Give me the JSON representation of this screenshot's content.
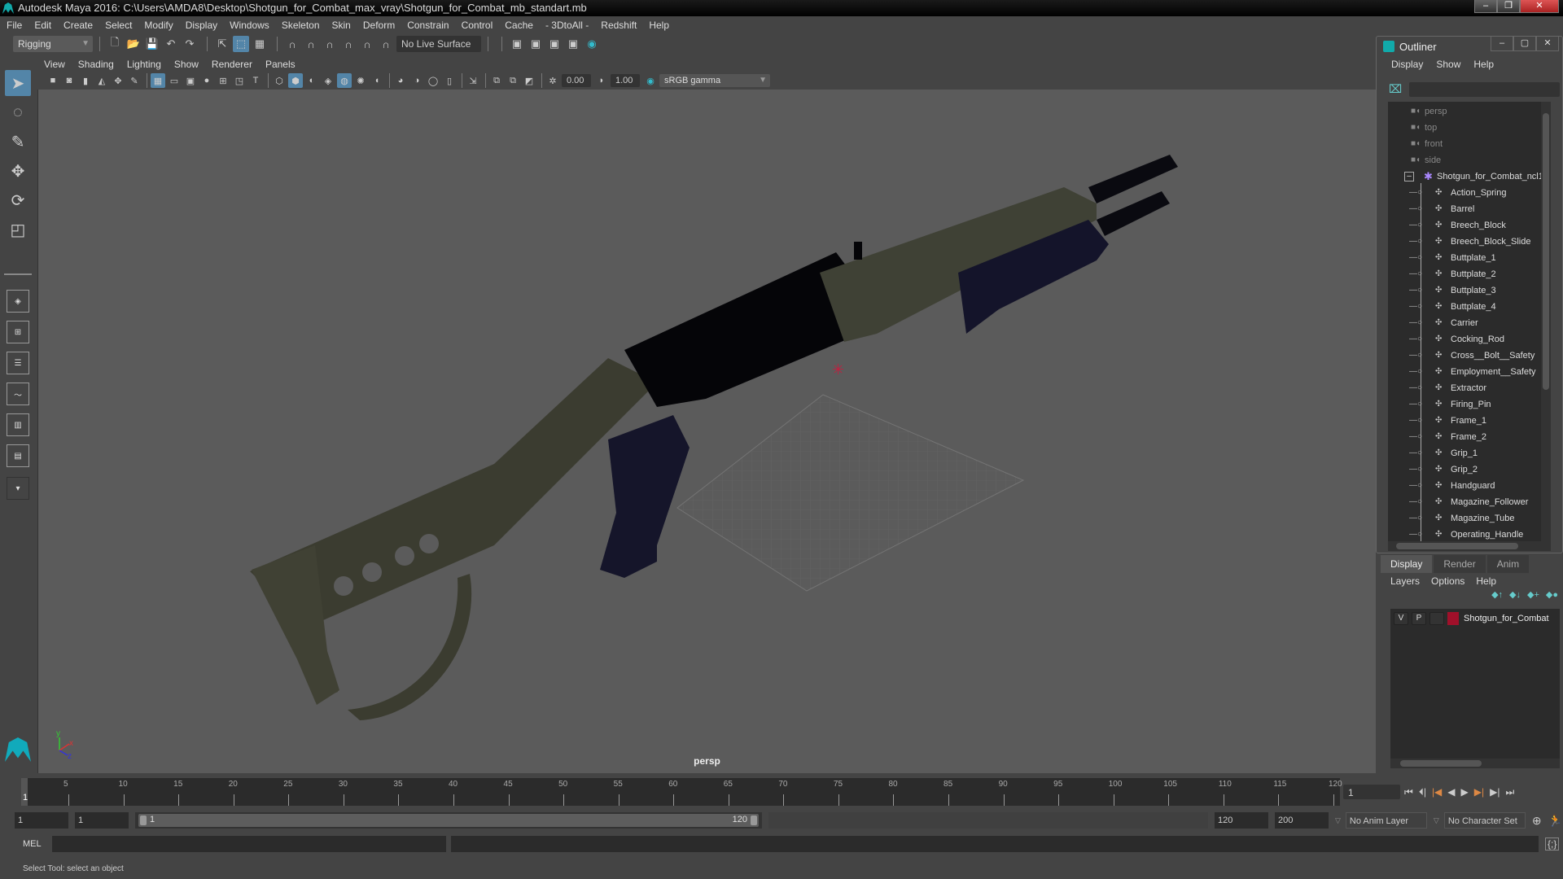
{
  "window": {
    "title": "Autodesk Maya 2016: C:\\Users\\AMDA8\\Desktop\\Shotgun_for_Combat_max_vray\\Shotgun_for_Combat_mb_standart.mb",
    "minimize": "–",
    "restore": "❐",
    "close": "✕"
  },
  "menubar": [
    "File",
    "Edit",
    "Create",
    "Select",
    "Modify",
    "Display",
    "Windows",
    "Skeleton",
    "Skin",
    "Deform",
    "Constrain",
    "Control",
    "Cache",
    "- 3DtoAll -",
    "Redshift",
    "Help"
  ],
  "shelf": {
    "mode": "Rigging",
    "live_surface": "No Live Surface"
  },
  "viewport": {
    "menu": [
      "View",
      "Shading",
      "Lighting",
      "Show",
      "Renderer",
      "Panels"
    ],
    "exposure": "0.00",
    "gamma": "1.00",
    "color_space": "sRGB gamma",
    "camera_name": "persp",
    "axis": {
      "x": "x",
      "y": "y",
      "z": "z"
    }
  },
  "outliner": {
    "title": "Outliner",
    "menu": [
      "Display",
      "Show",
      "Help"
    ],
    "cameras": [
      "persp",
      "top",
      "front",
      "side"
    ],
    "group": "Shotgun_for_Combat_ncl1",
    "children": [
      "Action_Spring",
      "Barrel",
      "Breech_Block",
      "Breech_Block_Slide",
      "Buttplate_1",
      "Buttplate_2",
      "Buttplate_3",
      "Buttplate_4",
      "Carrier",
      "Cocking_Rod",
      "Cross__Bolt__Safety",
      "Employment__Safety",
      "Extractor",
      "Firing_Pin",
      "Frame_1",
      "Frame_2",
      "Grip_1",
      "Grip_2",
      "Handguard",
      "Magazine_Follower",
      "Magazine_Tube",
      "Operating_Handle"
    ]
  },
  "layer_editor": {
    "tabs": [
      "Display",
      "Render",
      "Anim"
    ],
    "active_tab": "Display",
    "menu": [
      "Layers",
      "Options",
      "Help"
    ],
    "layers": [
      {
        "visible": "V",
        "playback": "P",
        "name": "Shotgun_for_Combat",
        "color": "#a0102a"
      }
    ]
  },
  "timeline": {
    "ticks": [
      "5",
      "10",
      "15",
      "20",
      "25",
      "30",
      "35",
      "40",
      "45",
      "50",
      "55",
      "60",
      "65",
      "70",
      "75",
      "80",
      "85",
      "90",
      "95",
      "100",
      "105",
      "110",
      "115",
      "120"
    ],
    "start_label": "1",
    "current_frame": "1"
  },
  "range": {
    "start": "1",
    "playback_start": "1",
    "slider_start": "1",
    "slider_end": "120",
    "playback_end": "120",
    "end": "200",
    "anim_layer": "No Anim Layer",
    "character_set": "No Character Set"
  },
  "command_line": {
    "label": "MEL",
    "value": ""
  },
  "status": "Select Tool: select an object"
}
